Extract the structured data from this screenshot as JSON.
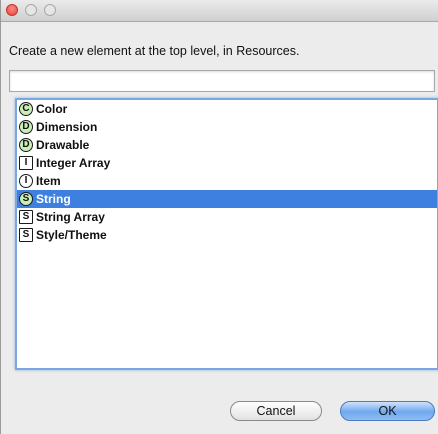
{
  "window": {
    "traffic_lights": [
      "close",
      "minimize",
      "zoom"
    ]
  },
  "dialog": {
    "prompt": "Create a new element at the top level, in Resources.",
    "filter": {
      "value": "",
      "placeholder": ""
    },
    "items": [
      {
        "label": "Color",
        "icon_letter": "C",
        "icon_shape": "circle",
        "icon_fill": "green",
        "selected": false
      },
      {
        "label": "Dimension",
        "icon_letter": "D",
        "icon_shape": "circle",
        "icon_fill": "green",
        "selected": false
      },
      {
        "label": "Drawable",
        "icon_letter": "D",
        "icon_shape": "circle",
        "icon_fill": "green",
        "selected": false
      },
      {
        "label": "Integer Array",
        "icon_letter": "I",
        "icon_shape": "square",
        "icon_fill": "white",
        "selected": false
      },
      {
        "label": "Item",
        "icon_letter": "I",
        "icon_shape": "circle",
        "icon_fill": "white",
        "selected": false
      },
      {
        "label": "String",
        "icon_letter": "S",
        "icon_shape": "circle",
        "icon_fill": "green",
        "selected": true
      },
      {
        "label": "String Array",
        "icon_letter": "S",
        "icon_shape": "square",
        "icon_fill": "white",
        "selected": false
      },
      {
        "label": "Style/Theme",
        "icon_letter": "S",
        "icon_shape": "square",
        "icon_fill": "white",
        "selected": false
      }
    ],
    "buttons": {
      "cancel": "Cancel",
      "ok": "OK"
    }
  },
  "colors": {
    "selection": "#3d80df",
    "focus_ring": "#7aa7e0",
    "icon_green": "#c9efb8"
  }
}
